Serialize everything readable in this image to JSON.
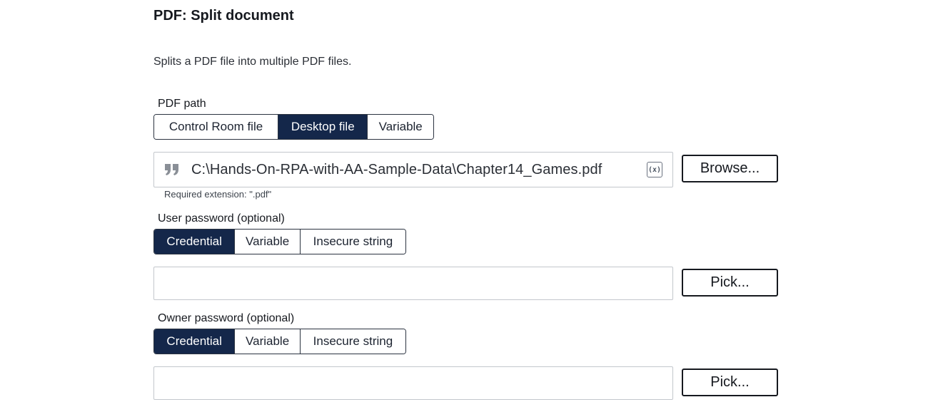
{
  "header": {
    "title": "PDF: Split document",
    "description": "Splits a PDF file into multiple PDF files."
  },
  "pdf_path": {
    "label": "PDF path",
    "options": [
      "Control Room file",
      "Desktop file",
      "Variable"
    ],
    "selected": "Desktop file",
    "value": "C:\\Hands-On-RPA-with-AA-Sample-Data\\Chapter14_Games.pdf",
    "insert_variable_icon": "(x)",
    "hint": "Required extension: \".pdf\"",
    "browse_label": "Browse..."
  },
  "user_password": {
    "label": "User password (optional)",
    "options": [
      "Credential",
      "Variable",
      "Insecure string"
    ],
    "selected": "Credential",
    "value": "",
    "pick_label": "Pick..."
  },
  "owner_password": {
    "label": "Owner password (optional)",
    "options": [
      "Credential",
      "Variable",
      "Insecure string"
    ],
    "selected": "Credential",
    "value": "",
    "pick_label": "Pick..."
  },
  "colors": {
    "active_segment": "#14274a",
    "border": "#2b3340"
  }
}
